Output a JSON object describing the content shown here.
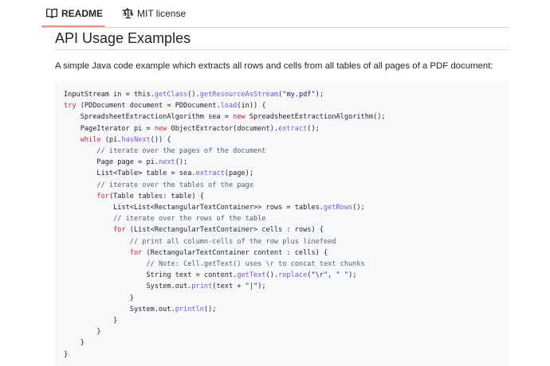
{
  "tabs": [
    {
      "label": "README",
      "icon": "book-icon",
      "active": true
    },
    {
      "label": "MIT license",
      "icon": "law-scale-icon",
      "active": false
    }
  ],
  "accent_color": "#fd8c73",
  "heading": "API Usage Examples",
  "description": "A simple Java code example which extracts all rows and cells from all tables of all pages of a PDF document:",
  "code_lines": [
    [
      {
        "t": "InputStream in = this."
      },
      {
        "t": "getClass",
        "c": "f"
      },
      {
        "t": "()."
      },
      {
        "t": "getResourceAsStream",
        "c": "f"
      },
      {
        "t": "("
      },
      {
        "t": "\"my.pdf\"",
        "c": "s"
      },
      {
        "t": ");"
      }
    ],
    [
      {
        "t": "try",
        "c": "k"
      },
      {
        "t": " (PDDocument document = PDDocument."
      },
      {
        "t": "load",
        "c": "f"
      },
      {
        "t": "(in)) {"
      }
    ],
    [
      {
        "t": "    SpreadsheetExtractionAlgorithm sea = "
      },
      {
        "t": "new",
        "c": "k"
      },
      {
        "t": " SpreadsheetExtractionAlgorithm();"
      }
    ],
    [
      {
        "t": "    PageIterator pi = "
      },
      {
        "t": "new",
        "c": "k"
      },
      {
        "t": " ObjectExtractor(document)."
      },
      {
        "t": "extract",
        "c": "f"
      },
      {
        "t": "();"
      }
    ],
    [
      {
        "t": "    "
      },
      {
        "t": "while",
        "c": "k"
      },
      {
        "t": " (pi."
      },
      {
        "t": "hasNext",
        "c": "f"
      },
      {
        "t": "()) {"
      }
    ],
    [
      {
        "t": "        // iterate over the pages of the document",
        "c": "c"
      }
    ],
    [
      {
        "t": "        Page page = pi."
      },
      {
        "t": "next",
        "c": "f"
      },
      {
        "t": "();"
      }
    ],
    [
      {
        "t": "        List<Table> table = sea."
      },
      {
        "t": "extract",
        "c": "f"
      },
      {
        "t": "(page);"
      }
    ],
    [
      {
        "t": "        // iterate over the tables of the page",
        "c": "c"
      }
    ],
    [
      {
        "t": "        "
      },
      {
        "t": "for",
        "c": "k"
      },
      {
        "t": "(Table tables: table) {"
      }
    ],
    [
      {
        "t": "            List<List<RectangularTextContainer>> rows = tables."
      },
      {
        "t": "getRows",
        "c": "f"
      },
      {
        "t": "();"
      }
    ],
    [
      {
        "t": "            // iterate over the rows of the table",
        "c": "c"
      }
    ],
    [
      {
        "t": "            "
      },
      {
        "t": "for",
        "c": "k"
      },
      {
        "t": " (List<RectangularTextContainer> cells : rows) {"
      }
    ],
    [
      {
        "t": "                // print all column-cells of the row plus linefeed",
        "c": "c"
      }
    ],
    [
      {
        "t": "                "
      },
      {
        "t": "for",
        "c": "k"
      },
      {
        "t": " (RectangularTextContainer content : cells) {"
      }
    ],
    [
      {
        "t": "                    // Note: Cell.getText() uses \\r to concat text chunks",
        "c": "c"
      }
    ],
    [
      {
        "t": "                    String text = content."
      },
      {
        "t": "getText",
        "c": "f"
      },
      {
        "t": "()."
      },
      {
        "t": "replace",
        "c": "f"
      },
      {
        "t": "("
      },
      {
        "t": "\"\\r\"",
        "c": "s"
      },
      {
        "t": ", "
      },
      {
        "t": "\" \"",
        "c": "s"
      },
      {
        "t": ");"
      }
    ],
    [
      {
        "t": "                    System.out."
      },
      {
        "t": "print",
        "c": "f"
      },
      {
        "t": "(text + "
      },
      {
        "t": "\"|\"",
        "c": "s"
      },
      {
        "t": ");"
      }
    ],
    [
      {
        "t": "                }"
      }
    ],
    [
      {
        "t": "                System.out."
      },
      {
        "t": "println",
        "c": "f"
      },
      {
        "t": "();"
      }
    ],
    [
      {
        "t": "            }"
      }
    ],
    [
      {
        "t": "        }"
      }
    ],
    [
      {
        "t": "    }"
      }
    ],
    [
      {
        "t": "}"
      }
    ]
  ]
}
